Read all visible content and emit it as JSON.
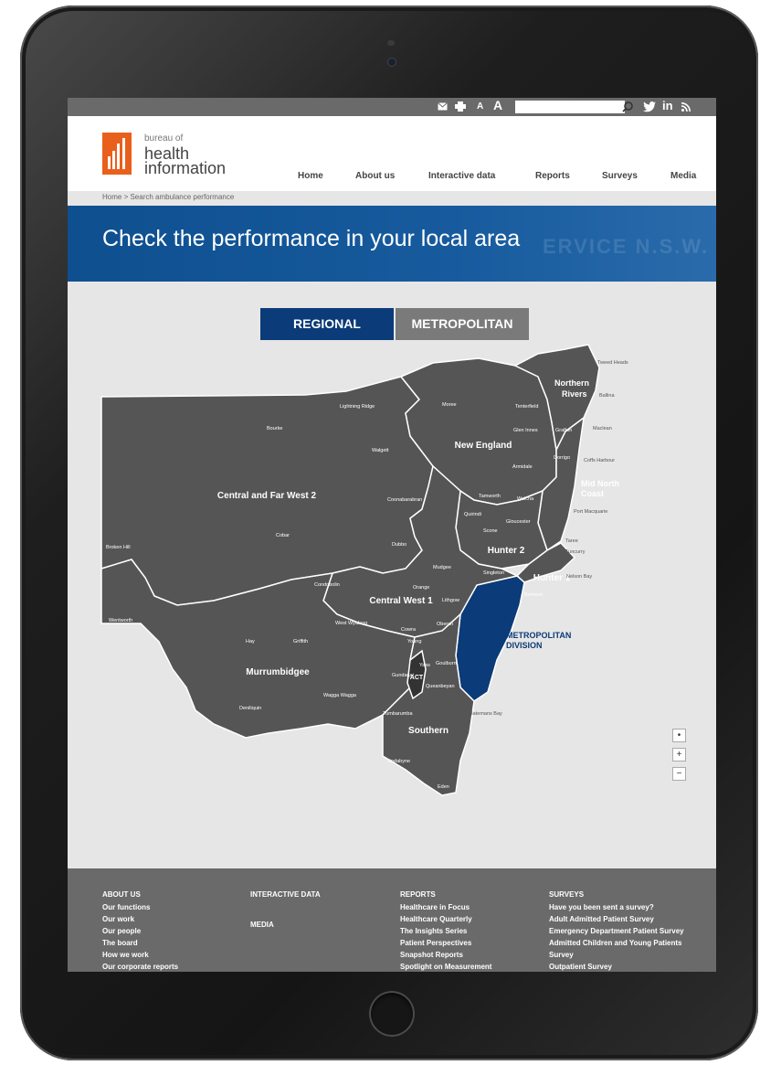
{
  "topbar": {
    "icons": [
      "envelope-icon",
      "print-icon",
      "text-small-icon",
      "text-large-icon",
      "search-icon",
      "twitter-icon",
      "linkedin-icon",
      "rss-icon"
    ],
    "text_small": "A",
    "text_large": "A",
    "search_placeholder": ""
  },
  "logo": {
    "line1": "bureau of",
    "line2": "health",
    "line3": "information",
    "color": "#e8601c"
  },
  "nav": [
    "Home",
    "About us",
    "Interactive data",
    "Reports",
    "Surveys",
    "Media"
  ],
  "breadcrumb": "Home > Search ambulance performance",
  "banner": {
    "title": "Check the performance in your local area",
    "watermark": "ERVICE N.S.W."
  },
  "tabs": {
    "regional": "REGIONAL",
    "metropolitan": "METROPOLITAN",
    "active": "regional"
  },
  "map": {
    "regions": [
      "Central and Far West 2",
      "New England",
      "Northern Rivers",
      "Mid North Coast",
      "Hunter 2",
      "Hunter 1",
      "Central West 1",
      "Murrumbidgee",
      "Southern",
      "ACT",
      "METROPOLITAN DIVISION"
    ],
    "towns": [
      "Tweed Heads",
      "Ballina",
      "Lightning Ridge",
      "Moree",
      "Tenterfield",
      "Bourke",
      "Glen Innes",
      "Grafton",
      "Maclean",
      "Walgett",
      "Armidale",
      "Dorrigo",
      "Coffs Harbour",
      "Tamworth",
      "Walcha",
      "Coonabarabran",
      "Quirindi",
      "Port Macquarie",
      "Gloucester",
      "Scone",
      "Taree",
      "Cobar",
      "Dubbo",
      "Tuncurry",
      "Broken Hill",
      "Mudgee",
      "Singleton",
      "Nelson Bay",
      "Belmont",
      "Condobolin",
      "Orange",
      "Lithgow",
      "West Wyalong",
      "Cowra",
      "Oberon",
      "Wentworth",
      "Young",
      "Hay",
      "Griffith",
      "Yass",
      "Goulburn",
      "Gundagai",
      "Queanbeyan",
      "Wagga Wagga",
      "Deniliquin",
      "Tumbarumba",
      "Batemans Bay",
      "Jindabyne",
      "Eden"
    ],
    "colors": {
      "region": "#555555",
      "border": "#ffffff",
      "metro": "#0b3b78",
      "act": "#333333"
    }
  },
  "zoom": {
    "reset": "•",
    "in": "+",
    "out": "−"
  },
  "footer": {
    "about": {
      "heading": "ABOUT US",
      "items": [
        "Our functions",
        "Our work",
        "Our people",
        "The board",
        "How we work",
        "Our corporate reports"
      ]
    },
    "interactive": {
      "heading": "INTERACTIVE DATA"
    },
    "media": {
      "heading": "MEDIA"
    },
    "reports": {
      "heading": "REPORTS",
      "items": [
        "Healthcare in Focus",
        "Healthcare Quarterly",
        "The Insights Series",
        "Patient Perspectives",
        "Snapshot Reports",
        "Spotlight on Measurement"
      ]
    },
    "surveys": {
      "heading": "SURVEYS",
      "items": [
        "Have you been sent a survey?",
        "Adult Admitted Patient Survey",
        "Emergency Department Patient Survey",
        "Admitted Children and Young Patients",
        "Survey",
        "Outpatient Survey"
      ]
    }
  }
}
